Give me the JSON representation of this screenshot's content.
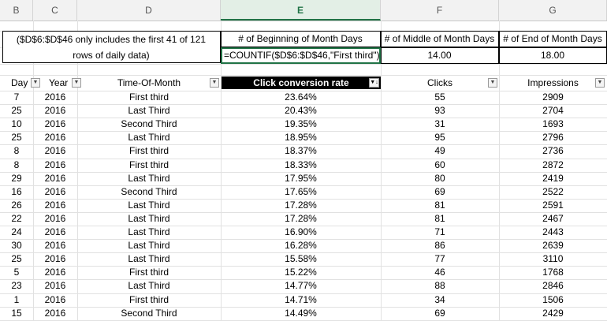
{
  "column_headers": [
    "B",
    "C",
    "D",
    "E",
    "F",
    "G"
  ],
  "selected_column": "E",
  "note_text": [
    "($D$6:$D$46 only includes the first 41 of 121",
    "rows of daily data)"
  ],
  "summary_headers": {
    "beginning": "# of Beginning of Month Days",
    "middle": "# of Middle of Month Days",
    "end": "# of End of Month Days"
  },
  "summary_values": {
    "beginning_formula": "=COUNTIF($D$6:$D$46,\"First third\")",
    "middle": "14.00",
    "end": "18.00"
  },
  "table_headers": {
    "day": "Day",
    "year": "Year",
    "time_of_month": "Time-Of-Month",
    "conversion": "Click conversion rate",
    "clicks": "Clicks",
    "impressions": "Impressions"
  },
  "rows": [
    {
      "day": "7",
      "year": "2016",
      "tom": "First third",
      "rate": "23.64%",
      "clicks": "55",
      "impr": "2909"
    },
    {
      "day": "25",
      "year": "2016",
      "tom": "Last Third",
      "rate": "20.43%",
      "clicks": "93",
      "impr": "2704"
    },
    {
      "day": "10",
      "year": "2016",
      "tom": "Second Third",
      "rate": "19.35%",
      "clicks": "31",
      "impr": "1693"
    },
    {
      "day": "25",
      "year": "2016",
      "tom": "Last Third",
      "rate": "18.95%",
      "clicks": "95",
      "impr": "2796"
    },
    {
      "day": "8",
      "year": "2016",
      "tom": "First third",
      "rate": "18.37%",
      "clicks": "49",
      "impr": "2736"
    },
    {
      "day": "8",
      "year": "2016",
      "tom": "First third",
      "rate": "18.33%",
      "clicks": "60",
      "impr": "2872"
    },
    {
      "day": "29",
      "year": "2016",
      "tom": "Last Third",
      "rate": "17.95%",
      "clicks": "80",
      "impr": "2419"
    },
    {
      "day": "16",
      "year": "2016",
      "tom": "Second Third",
      "rate": "17.65%",
      "clicks": "69",
      "impr": "2522"
    },
    {
      "day": "26",
      "year": "2016",
      "tom": "Last Third",
      "rate": "17.28%",
      "clicks": "81",
      "impr": "2591"
    },
    {
      "day": "22",
      "year": "2016",
      "tom": "Last Third",
      "rate": "17.28%",
      "clicks": "81",
      "impr": "2467"
    },
    {
      "day": "24",
      "year": "2016",
      "tom": "Last Third",
      "rate": "16.90%",
      "clicks": "71",
      "impr": "2443"
    },
    {
      "day": "30",
      "year": "2016",
      "tom": "Last Third",
      "rate": "16.28%",
      "clicks": "86",
      "impr": "2639"
    },
    {
      "day": "25",
      "year": "2016",
      "tom": "Last Third",
      "rate": "15.58%",
      "clicks": "77",
      "impr": "3110"
    },
    {
      "day": "5",
      "year": "2016",
      "tom": "First third",
      "rate": "15.22%",
      "clicks": "46",
      "impr": "1768"
    },
    {
      "day": "23",
      "year": "2016",
      "tom": "Last Third",
      "rate": "14.77%",
      "clicks": "88",
      "impr": "2846"
    },
    {
      "day": "1",
      "year": "2016",
      "tom": "First third",
      "rate": "14.71%",
      "clicks": "34",
      "impr": "1506"
    },
    {
      "day": "15",
      "year": "2016",
      "tom": "Second Third",
      "rate": "14.49%",
      "clicks": "69",
      "impr": "2429"
    }
  ],
  "icons": {
    "filter_dropdown": "filter-dropdown-icon",
    "sort_filter": "sort-descending-filter-icon"
  },
  "colors": {
    "selection_accent": "#217346",
    "header_fill": "#000000"
  }
}
